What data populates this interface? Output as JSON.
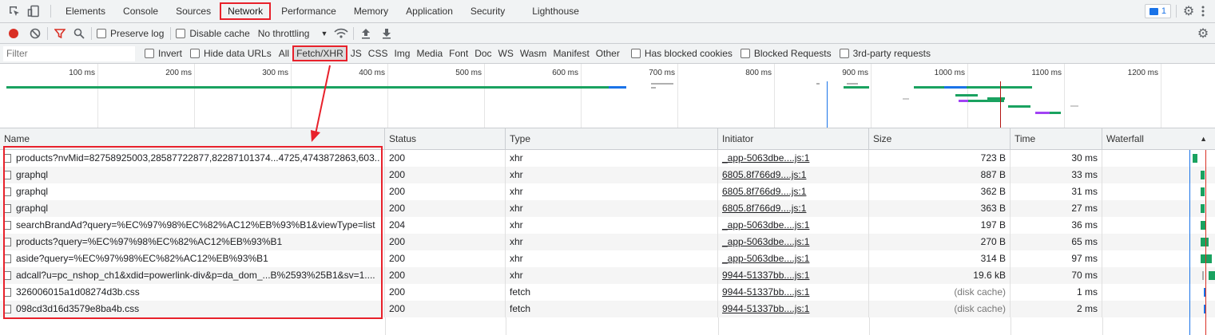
{
  "tabs": [
    "Elements",
    "Console",
    "Sources",
    "Network",
    "Performance",
    "Memory",
    "Application",
    "Security",
    "Lighthouse"
  ],
  "active_tab": "Network",
  "issues_badge": "1",
  "toolbar": {
    "preserve_log": "Preserve log",
    "disable_cache": "Disable cache",
    "throttling": "No throttling"
  },
  "filterbar": {
    "filter_placeholder": "Filter",
    "invert": "Invert",
    "hide_data_urls": "Hide data URLs",
    "types": [
      "All",
      "Fetch/XHR",
      "JS",
      "CSS",
      "Img",
      "Media",
      "Font",
      "Doc",
      "WS",
      "Wasm",
      "Manifest",
      "Other"
    ],
    "selected_type": "Fetch/XHR",
    "has_blocked_cookies": "Has blocked cookies",
    "blocked_requests": "Blocked Requests",
    "third_party": "3rd-party requests"
  },
  "timeline": {
    "ticks": [
      "100 ms",
      "200 ms",
      "300 ms",
      "400 ms",
      "500 ms",
      "600 ms",
      "700 ms",
      "800 ms",
      "900 ms",
      "1000 ms",
      "1100 ms",
      "1200 ms"
    ]
  },
  "table": {
    "columns": [
      "Name",
      "Status",
      "Type",
      "Initiator",
      "Size",
      "Time",
      "Waterfall"
    ],
    "rows": [
      {
        "name": "products?nvMid=82758925003,28587722877,82287101374...4725,4743872863,603...",
        "status": "200",
        "type": "xhr",
        "initiator": "_app-5063dbe....js:1",
        "size": "723 B",
        "time": "30 ms"
      },
      {
        "name": "graphql",
        "status": "200",
        "type": "xhr",
        "initiator": "6805.8f766d9....js:1",
        "size": "887 B",
        "time": "33 ms"
      },
      {
        "name": "graphql",
        "status": "200",
        "type": "xhr",
        "initiator": "6805.8f766d9....js:1",
        "size": "362 B",
        "time": "31 ms"
      },
      {
        "name": "graphql",
        "status": "200",
        "type": "xhr",
        "initiator": "6805.8f766d9....js:1",
        "size": "363 B",
        "time": "27 ms"
      },
      {
        "name": "searchBrandAd?query=%EC%97%98%EC%82%AC12%EB%93%B1&viewType=list",
        "status": "204",
        "type": "xhr",
        "initiator": "_app-5063dbe....js:1",
        "size": "197 B",
        "time": "36 ms"
      },
      {
        "name": "products?query=%EC%97%98%EC%82%AC12%EB%93%B1",
        "status": "200",
        "type": "xhr",
        "initiator": "_app-5063dbe....js:1",
        "size": "270 B",
        "time": "65 ms"
      },
      {
        "name": "aside?query=%EC%97%98%EC%82%AC12%EB%93%B1",
        "status": "200",
        "type": "xhr",
        "initiator": "_app-5063dbe....js:1",
        "size": "314 B",
        "time": "97 ms"
      },
      {
        "name": "adcall?u=pc_nshop_ch1&xdid=powerlink-div&p=da_dom_...B%2593%25B1&sv=1....",
        "status": "200",
        "type": "xhr",
        "initiator": "9944-51337bb....js:1",
        "size": "19.6 kB",
        "time": "70 ms"
      },
      {
        "name": "326006015a1d08274d3b.css",
        "status": "200",
        "type": "fetch",
        "initiator": "9944-51337bb....js:1",
        "size": "(disk cache)",
        "time": "1 ms"
      },
      {
        "name": "098cd3d16d3579e8ba4b.css",
        "status": "200",
        "type": "fetch",
        "initiator": "9944-51337bb....js:1",
        "size": "(disk cache)",
        "time": "2 ms"
      }
    ]
  },
  "colors": {
    "accent_red": "#e8212b",
    "record_red": "#d93025",
    "bar_green": "#1aa260",
    "bar_blue": "#1a73e8"
  }
}
